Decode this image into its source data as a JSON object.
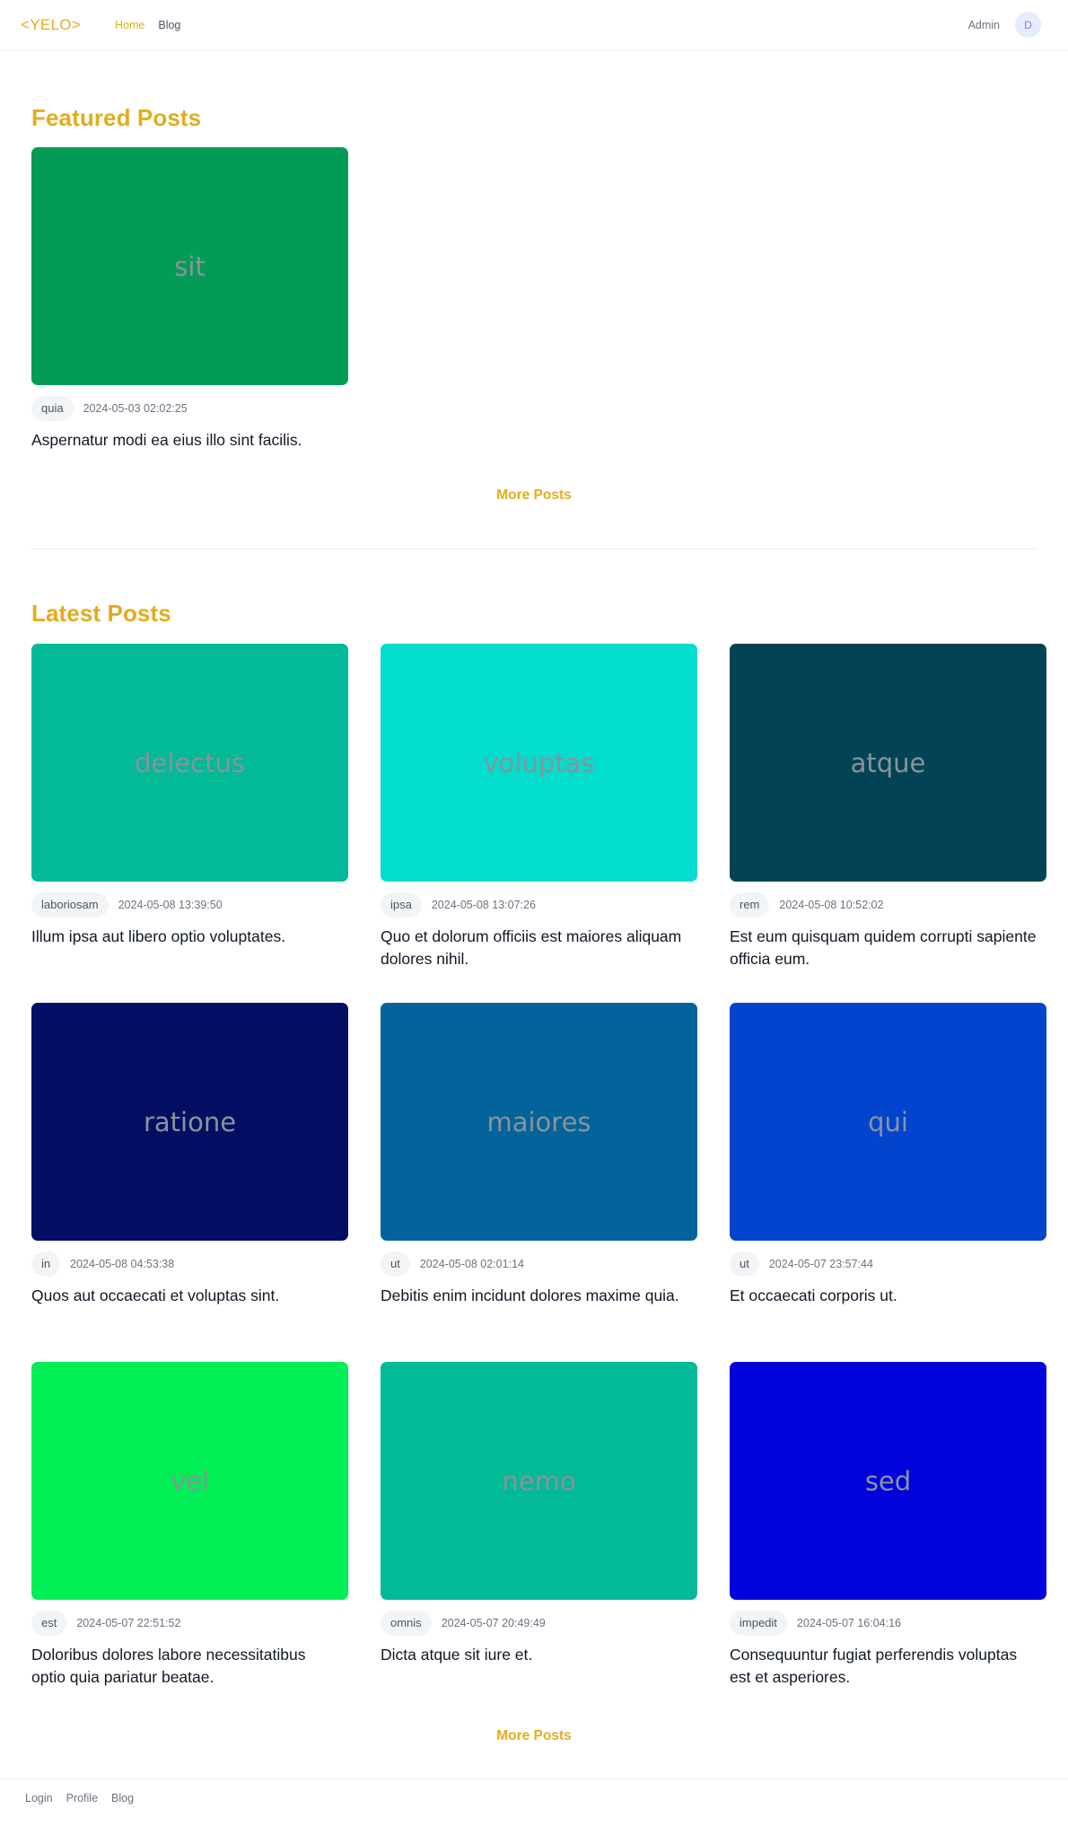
{
  "nav": {
    "logo": "<YELO>",
    "links": [
      "Home",
      "Blog"
    ],
    "admin": "Admin",
    "avatar_initial": "D"
  },
  "featured": {
    "title": "Featured Posts",
    "posts": [
      {
        "thumb_word": "sit",
        "color": "#049b57",
        "tag": "quia",
        "date": "2024-05-03 02:02:25",
        "title": "Aspernatur modi ea eius illo sint facilis."
      }
    ],
    "more": "More Posts"
  },
  "latest": {
    "title": "Latest Posts",
    "posts": [
      {
        "thumb_word": "delectus",
        "color": "#02b998",
        "tag": "laboriosam",
        "date": "2024-05-08 13:39:50",
        "title": "Illum ipsa aut libero optio voluptates."
      },
      {
        "thumb_word": "voluptas",
        "color": "#02ddcd",
        "tag": "ipsa",
        "date": "2024-05-08 13:07:26",
        "title": "Quo et dolorum officiis est maiores aliquam dolores nihil."
      },
      {
        "thumb_word": "atque",
        "color": "#024455",
        "tag": "rem",
        "date": "2024-05-08 10:52:02",
        "title": "Est eum quisquam quidem corrupti sapiente officia eum."
      },
      {
        "thumb_word": "ratione",
        "color": "#020f62",
        "tag": "in",
        "date": "2024-05-08 04:53:38",
        "title": "Quos aut occaecati et voluptas sint."
      },
      {
        "thumb_word": "maiores",
        "color": "#02649b",
        "tag": "ut",
        "date": "2024-05-08 02:01:14",
        "title": "Debitis enim incidunt dolores maxime quia."
      },
      {
        "thumb_word": "qui",
        "color": "#0244cd",
        "tag": "ut",
        "date": "2024-05-07 23:57:44",
        "title": "Et occaecati corporis ut."
      },
      {
        "thumb_word": "vel",
        "color": "#02ee55",
        "tag": "est",
        "date": "2024-05-07 22:51:52",
        "title": "Doloribus dolores labore necessitatibus optio quia pariatur beatae."
      },
      {
        "thumb_word": "nemo",
        "color": "#02b998",
        "tag": "omnis",
        "date": "2024-05-07 20:49:49",
        "title": "Dicta atque sit iure et."
      },
      {
        "thumb_word": "sed",
        "color": "#0202dd",
        "tag": "impedit",
        "date": "2024-05-07 16:04:16",
        "title": "Consequuntur fugiat perferendis voluptas est et asperiores."
      }
    ],
    "more": "More Posts"
  },
  "footer": {
    "links": [
      "Login",
      "Profile",
      "Blog"
    ]
  }
}
